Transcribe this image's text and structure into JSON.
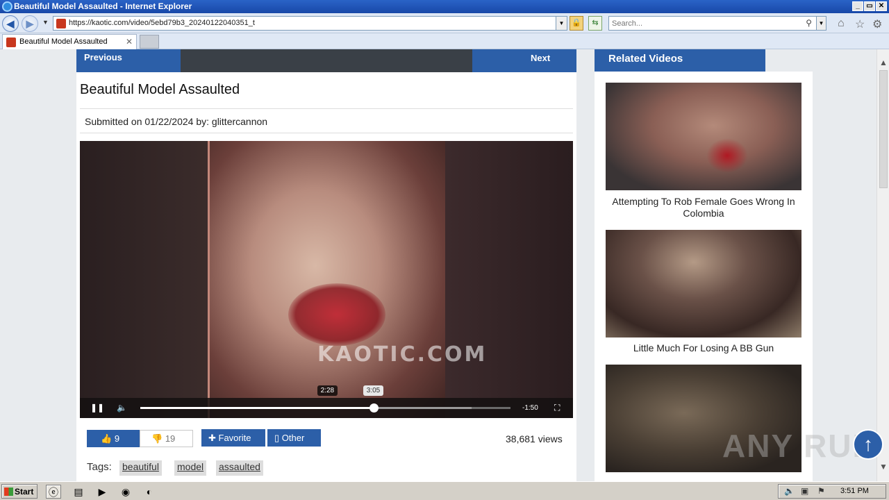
{
  "window": {
    "title": "Beautiful Model Assaulted - Internet Explorer",
    "controls": {
      "minimize": "_",
      "maximize": "▭",
      "close": "✕"
    }
  },
  "navbar": {
    "url": "https://kaotic.com/video/5ebd79b3_20240122040351_t",
    "search_placeholder": "Search..."
  },
  "tabs": [
    {
      "label": "Beautiful Model Assaulted"
    }
  ],
  "page": {
    "prev_label": "Previous",
    "next_label": "Next",
    "title": "Beautiful Model Assaulted",
    "submitted": "Submitted on 01/22/2024 by: glittercannon",
    "video": {
      "watermark": "KAOTIC.COM",
      "hover_time": "2:28",
      "current_time": "3:05",
      "remaining": "-1:50",
      "progress_fraction": 0.63,
      "hover_fraction": 0.504,
      "buffer_fraction": 0.895
    },
    "likes": "9",
    "dislikes": "19",
    "favorite_label": "Favorite",
    "other_label": "Other",
    "views": "38,681 views",
    "tags_label": "Tags:",
    "tags": [
      "beautiful",
      "model",
      "assaulted"
    ]
  },
  "sidebar": {
    "header": "Related Videos",
    "items": [
      {
        "title": "Attempting To Rob Female Goes Wrong In Colombia"
      },
      {
        "title": "Little Much For Losing A BB Gun"
      },
      {
        "title": ""
      }
    ]
  },
  "overlay": {
    "brand": "ANY RUN"
  },
  "taskbar": {
    "start_label": "Start",
    "clock": "3:51 PM"
  }
}
